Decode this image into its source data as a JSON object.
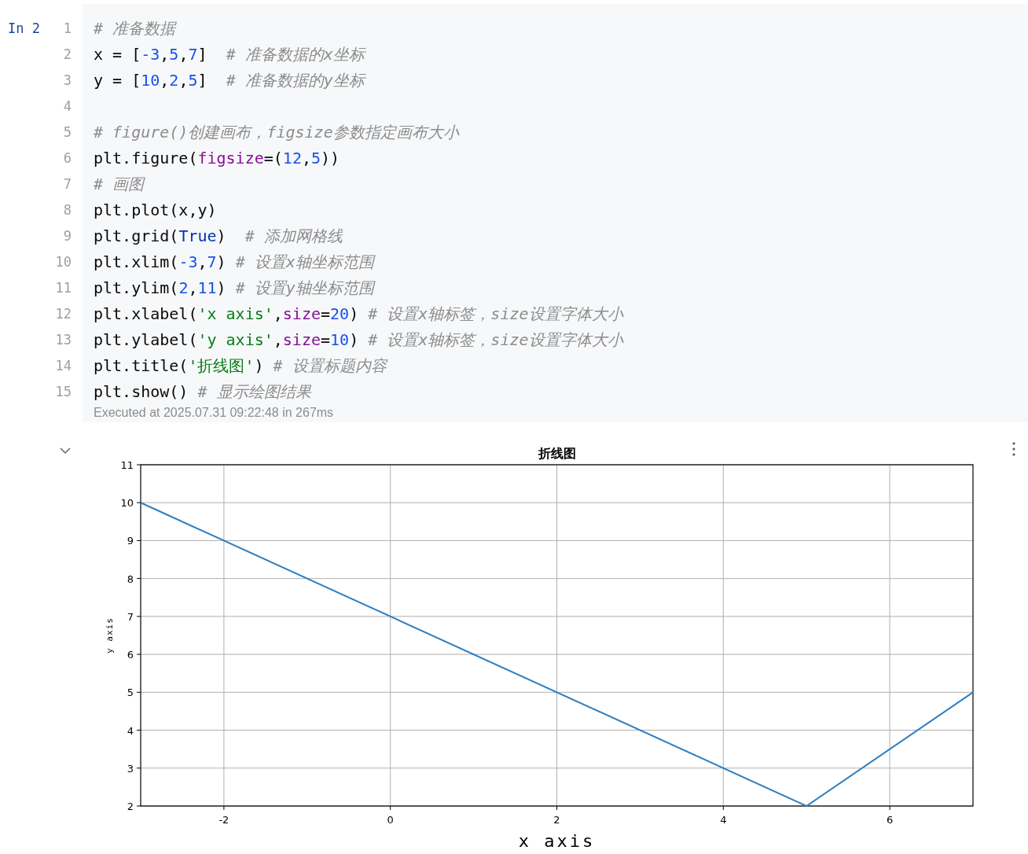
{
  "cell": {
    "prompt": "In 2",
    "lines": [
      {
        "number": "1",
        "tokens": [
          {
            "kind": "comment",
            "text": "# 准备数据"
          }
        ]
      },
      {
        "number": "2",
        "tokens": [
          {
            "kind": "plain",
            "text": "x = ["
          },
          {
            "kind": "num",
            "text": "-3"
          },
          {
            "kind": "plain",
            "text": ","
          },
          {
            "kind": "num",
            "text": "5"
          },
          {
            "kind": "plain",
            "text": ","
          },
          {
            "kind": "num",
            "text": "7"
          },
          {
            "kind": "plain",
            "text": "]  "
          },
          {
            "kind": "comment",
            "text": "# 准备数据的x坐标"
          }
        ]
      },
      {
        "number": "3",
        "tokens": [
          {
            "kind": "plain",
            "text": "y = ["
          },
          {
            "kind": "num",
            "text": "10"
          },
          {
            "kind": "plain",
            "text": ","
          },
          {
            "kind": "num",
            "text": "2"
          },
          {
            "kind": "plain",
            "text": ","
          },
          {
            "kind": "num",
            "text": "5"
          },
          {
            "kind": "plain",
            "text": "]  "
          },
          {
            "kind": "comment",
            "text": "# 准备数据的y坐标"
          }
        ]
      },
      {
        "number": "4"
      },
      {
        "number": "5",
        "tokens": [
          {
            "kind": "comment",
            "text": "# figure()创建画布，figsize参数指定画布大小"
          }
        ]
      },
      {
        "number": "6",
        "tokens": [
          {
            "kind": "plain",
            "text": "plt.figure("
          },
          {
            "kind": "param",
            "text": "figsize"
          },
          {
            "kind": "plain",
            "text": "=("
          },
          {
            "kind": "num",
            "text": "12"
          },
          {
            "kind": "plain",
            "text": ","
          },
          {
            "kind": "num",
            "text": "5"
          },
          {
            "kind": "plain",
            "text": "))"
          }
        ]
      },
      {
        "number": "7",
        "tokens": [
          {
            "kind": "comment",
            "text": "# 画图"
          }
        ]
      },
      {
        "number": "8",
        "tokens": [
          {
            "kind": "plain",
            "text": "plt.plot(x,y)"
          }
        ]
      },
      {
        "number": "9",
        "tokens": [
          {
            "kind": "plain",
            "text": "plt.grid("
          },
          {
            "kind": "keyword",
            "text": "True"
          },
          {
            "kind": "plain",
            "text": ")  "
          },
          {
            "kind": "comment",
            "text": "# 添加网格线"
          }
        ]
      },
      {
        "number": "10",
        "tokens": [
          {
            "kind": "plain",
            "text": "plt.xlim("
          },
          {
            "kind": "num",
            "text": "-3"
          },
          {
            "kind": "plain",
            "text": ","
          },
          {
            "kind": "num",
            "text": "7"
          },
          {
            "kind": "plain",
            "text": ") "
          },
          {
            "kind": "comment",
            "text": "# 设置x轴坐标范围"
          }
        ]
      },
      {
        "number": "11",
        "tokens": [
          {
            "kind": "plain",
            "text": "plt.ylim("
          },
          {
            "kind": "num",
            "text": "2"
          },
          {
            "kind": "plain",
            "text": ","
          },
          {
            "kind": "num",
            "text": "11"
          },
          {
            "kind": "plain",
            "text": ") "
          },
          {
            "kind": "comment",
            "text": "# 设置y轴坐标范围"
          }
        ]
      },
      {
        "number": "12",
        "tokens": [
          {
            "kind": "plain",
            "text": "plt.xlabel("
          },
          {
            "kind": "string",
            "text": "'x axis'"
          },
          {
            "kind": "plain",
            "text": ","
          },
          {
            "kind": "param",
            "text": "size"
          },
          {
            "kind": "plain",
            "text": "="
          },
          {
            "kind": "num",
            "text": "20"
          },
          {
            "kind": "plain",
            "text": ") "
          },
          {
            "kind": "comment",
            "text": "# 设置x轴标签，size设置字体大小"
          }
        ]
      },
      {
        "number": "13",
        "tokens": [
          {
            "kind": "plain",
            "text": "plt.ylabel("
          },
          {
            "kind": "string",
            "text": "'y axis'"
          },
          {
            "kind": "plain",
            "text": ","
          },
          {
            "kind": "param",
            "text": "size"
          },
          {
            "kind": "plain",
            "text": "="
          },
          {
            "kind": "num",
            "text": "10"
          },
          {
            "kind": "plain",
            "text": ") "
          },
          {
            "kind": "comment",
            "text": "# 设置x轴标签，size设置字体大小"
          }
        ]
      },
      {
        "number": "14",
        "tokens": [
          {
            "kind": "plain",
            "text": "plt.title("
          },
          {
            "kind": "string",
            "text": "'折线图'"
          },
          {
            "kind": "plain",
            "text": ") "
          },
          {
            "kind": "comment",
            "text": "# 设置标题内容"
          }
        ]
      },
      {
        "number": "15",
        "tokens": [
          {
            "kind": "plain",
            "text": "plt.show() "
          },
          {
            "kind": "comment",
            "text": "# 显示绘图结果"
          }
        ]
      }
    ],
    "status": "Executed at 2025.07.31 09:22:48 in 267ms"
  },
  "output": {
    "expanded": true,
    "chart_data": {
      "type": "line",
      "title": "折线图",
      "xlabel": "x axis",
      "ylabel": "y axis",
      "x": [
        -3,
        5,
        7
      ],
      "grid": true,
      "series": [
        {
          "color": "#2f7fc1",
          "values": [
            10,
            2,
            5
          ]
        }
      ],
      "xlim": [
        -3,
        7
      ],
      "ylim": [
        2,
        11
      ],
      "xticks": [
        -2,
        0,
        2,
        4,
        6
      ],
      "yticks": [
        2,
        3,
        4,
        5,
        6,
        7,
        8,
        9,
        10,
        11
      ]
    }
  }
}
